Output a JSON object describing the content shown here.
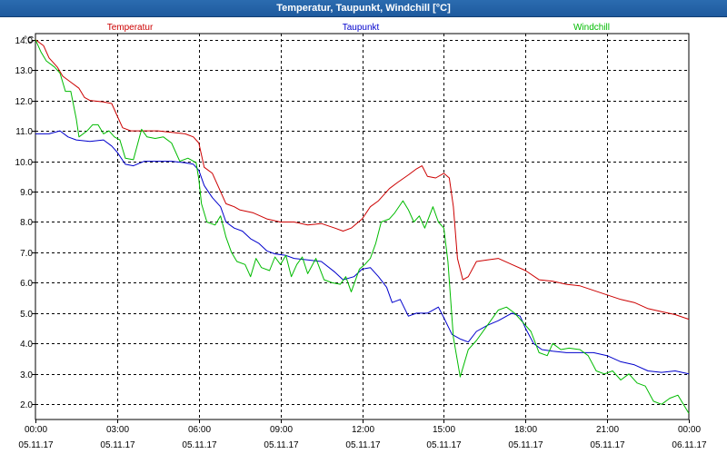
{
  "window": {
    "title": "Temperatur, Taupunkt, Windchill [°C]"
  },
  "chart_data": {
    "type": "line",
    "title": "Temperatur, Taupunkt, Windchill [°C]",
    "ylabel": "°C",
    "xlabel": "",
    "ylim": [
      1.5,
      14.2
    ],
    "xlim": [
      0,
      24
    ],
    "grid": true,
    "y_ticks": [
      "2.0",
      "3.0",
      "4.0",
      "5.0",
      "6.0",
      "7.0",
      "8.0",
      "9.0",
      "10.0",
      "11.0",
      "12.0",
      "13.0",
      "14.0"
    ],
    "y_tick_values": [
      2,
      3,
      4,
      5,
      6,
      7,
      8,
      9,
      10,
      11,
      12,
      13,
      14
    ],
    "x_ticks": [
      {
        "x": 0,
        "time": "00:00",
        "date": "05.11.17"
      },
      {
        "x": 3,
        "time": "03:00",
        "date": "05.11.17"
      },
      {
        "x": 6,
        "time": "06:00",
        "date": "05.11.17"
      },
      {
        "x": 9,
        "time": "09:00",
        "date": "05.11.17"
      },
      {
        "x": 12,
        "time": "12:00",
        "date": "05.11.17"
      },
      {
        "x": 15,
        "time": "15:00",
        "date": "05.11.17"
      },
      {
        "x": 18,
        "time": "18:00",
        "date": "05.11.17"
      },
      {
        "x": 21,
        "time": "21:00",
        "date": "05.11.17"
      },
      {
        "x": 24,
        "time": "00:00",
        "date": "06.11.17"
      }
    ],
    "series": [
      {
        "name": "Temperatur",
        "color": "#cc0000",
        "points": [
          [
            0,
            14.0
          ],
          [
            0.3,
            13.8
          ],
          [
            0.5,
            13.4
          ],
          [
            0.8,
            13.1
          ],
          [
            1.0,
            12.8
          ],
          [
            1.3,
            12.6
          ],
          [
            1.6,
            12.4
          ],
          [
            1.8,
            12.1
          ],
          [
            2.0,
            12.0
          ],
          [
            2.5,
            11.95
          ],
          [
            2.8,
            11.9
          ],
          [
            3.0,
            11.5
          ],
          [
            3.2,
            11.1
          ],
          [
            3.5,
            11.0
          ],
          [
            4.0,
            11.0
          ],
          [
            4.5,
            11.0
          ],
          [
            5.0,
            10.95
          ],
          [
            5.5,
            10.9
          ],
          [
            5.8,
            10.8
          ],
          [
            6.0,
            10.6
          ],
          [
            6.2,
            9.8
          ],
          [
            6.5,
            9.6
          ],
          [
            6.7,
            9.2
          ],
          [
            7.0,
            8.6
          ],
          [
            7.3,
            8.5
          ],
          [
            7.5,
            8.4
          ],
          [
            8.0,
            8.3
          ],
          [
            8.5,
            8.1
          ],
          [
            9.0,
            8.0
          ],
          [
            9.5,
            8.0
          ],
          [
            10.0,
            7.9
          ],
          [
            10.5,
            7.95
          ],
          [
            11.0,
            7.8
          ],
          [
            11.3,
            7.7
          ],
          [
            11.6,
            7.8
          ],
          [
            12.0,
            8.1
          ],
          [
            12.3,
            8.5
          ],
          [
            12.6,
            8.7
          ],
          [
            13.0,
            9.1
          ],
          [
            13.3,
            9.3
          ],
          [
            13.7,
            9.55
          ],
          [
            14.0,
            9.75
          ],
          [
            14.2,
            9.85
          ],
          [
            14.4,
            9.5
          ],
          [
            14.7,
            9.45
          ],
          [
            15.0,
            9.6
          ],
          [
            15.2,
            9.45
          ],
          [
            15.35,
            8.5
          ],
          [
            15.5,
            6.8
          ],
          [
            15.7,
            6.1
          ],
          [
            15.9,
            6.2
          ],
          [
            16.2,
            6.7
          ],
          [
            16.6,
            6.75
          ],
          [
            17.0,
            6.8
          ],
          [
            17.5,
            6.6
          ],
          [
            18.0,
            6.4
          ],
          [
            18.5,
            6.1
          ],
          [
            19.0,
            6.05
          ],
          [
            19.5,
            5.95
          ],
          [
            20.0,
            5.9
          ],
          [
            20.5,
            5.75
          ],
          [
            21.0,
            5.6
          ],
          [
            21.5,
            5.45
          ],
          [
            22.0,
            5.35
          ],
          [
            22.5,
            5.15
          ],
          [
            23.0,
            5.05
          ],
          [
            23.5,
            4.95
          ],
          [
            24.0,
            4.8
          ]
        ]
      },
      {
        "name": "Taupunkt",
        "color": "#0000cc",
        "points": [
          [
            0,
            10.9
          ],
          [
            0.5,
            10.9
          ],
          [
            0.9,
            11.0
          ],
          [
            1.2,
            10.8
          ],
          [
            1.5,
            10.7
          ],
          [
            2.0,
            10.65
          ],
          [
            2.5,
            10.7
          ],
          [
            2.8,
            10.5
          ],
          [
            3.0,
            10.3
          ],
          [
            3.3,
            9.9
          ],
          [
            3.6,
            9.85
          ],
          [
            4.0,
            10.0
          ],
          [
            4.5,
            10.0
          ],
          [
            5.0,
            10.0
          ],
          [
            5.5,
            9.95
          ],
          [
            5.8,
            9.9
          ],
          [
            6.0,
            9.7
          ],
          [
            6.2,
            9.2
          ],
          [
            6.5,
            8.8
          ],
          [
            6.8,
            8.5
          ],
          [
            7.0,
            8.0
          ],
          [
            7.3,
            7.8
          ],
          [
            7.6,
            7.7
          ],
          [
            7.9,
            7.45
          ],
          [
            8.2,
            7.3
          ],
          [
            8.5,
            7.05
          ],
          [
            8.8,
            6.95
          ],
          [
            9.2,
            6.9
          ],
          [
            9.5,
            6.8
          ],
          [
            10.0,
            6.75
          ],
          [
            10.5,
            6.7
          ],
          [
            11.0,
            6.35
          ],
          [
            11.3,
            6.1
          ],
          [
            11.7,
            6.2
          ],
          [
            12.0,
            6.45
          ],
          [
            12.3,
            6.5
          ],
          [
            12.6,
            6.2
          ],
          [
            12.9,
            5.85
          ],
          [
            13.1,
            5.35
          ],
          [
            13.4,
            5.45
          ],
          [
            13.7,
            4.9
          ],
          [
            14.0,
            5.0
          ],
          [
            14.4,
            5.0
          ],
          [
            14.8,
            5.2
          ],
          [
            15.0,
            4.85
          ],
          [
            15.3,
            4.3
          ],
          [
            15.6,
            4.15
          ],
          [
            15.9,
            4.05
          ],
          [
            16.2,
            4.4
          ],
          [
            16.6,
            4.6
          ],
          [
            17.0,
            4.75
          ],
          [
            17.5,
            5.0
          ],
          [
            17.8,
            4.9
          ],
          [
            18.0,
            4.5
          ],
          [
            18.3,
            4.0
          ],
          [
            18.6,
            3.8
          ],
          [
            19.0,
            3.75
          ],
          [
            19.5,
            3.7
          ],
          [
            20.0,
            3.7
          ],
          [
            20.5,
            3.7
          ],
          [
            21.0,
            3.6
          ],
          [
            21.5,
            3.4
          ],
          [
            22.0,
            3.3
          ],
          [
            22.5,
            3.1
          ],
          [
            23.0,
            3.05
          ],
          [
            23.5,
            3.1
          ],
          [
            24.0,
            3.0
          ]
        ]
      },
      {
        "name": "Windchill",
        "color": "#00bb00",
        "points": [
          [
            0,
            14.0
          ],
          [
            0.2,
            13.6
          ],
          [
            0.4,
            13.3
          ],
          [
            0.7,
            13.1
          ],
          [
            0.9,
            12.9
          ],
          [
            1.1,
            12.3
          ],
          [
            1.3,
            12.3
          ],
          [
            1.5,
            11.4
          ],
          [
            1.6,
            10.8
          ],
          [
            1.9,
            11.0
          ],
          [
            2.1,
            11.2
          ],
          [
            2.3,
            11.2
          ],
          [
            2.5,
            10.9
          ],
          [
            2.7,
            11.0
          ],
          [
            2.9,
            10.8
          ],
          [
            3.1,
            10.7
          ],
          [
            3.3,
            10.1
          ],
          [
            3.6,
            10.05
          ],
          [
            3.9,
            11.05
          ],
          [
            4.1,
            10.8
          ],
          [
            4.4,
            10.75
          ],
          [
            4.7,
            10.8
          ],
          [
            5.0,
            10.6
          ],
          [
            5.3,
            10.0
          ],
          [
            5.6,
            10.1
          ],
          [
            5.9,
            9.95
          ],
          [
            6.0,
            9.4
          ],
          [
            6.1,
            8.6
          ],
          [
            6.3,
            8.0
          ],
          [
            6.6,
            7.9
          ],
          [
            6.8,
            8.2
          ],
          [
            7.0,
            7.5
          ],
          [
            7.2,
            7.0
          ],
          [
            7.4,
            6.7
          ],
          [
            7.7,
            6.6
          ],
          [
            7.9,
            6.2
          ],
          [
            8.1,
            6.8
          ],
          [
            8.3,
            6.5
          ],
          [
            8.6,
            6.4
          ],
          [
            8.8,
            6.85
          ],
          [
            9.0,
            6.6
          ],
          [
            9.2,
            6.9
          ],
          [
            9.4,
            6.2
          ],
          [
            9.6,
            6.6
          ],
          [
            9.8,
            6.85
          ],
          [
            10.0,
            6.3
          ],
          [
            10.3,
            6.8
          ],
          [
            10.6,
            6.1
          ],
          [
            10.9,
            6.0
          ],
          [
            11.2,
            5.95
          ],
          [
            11.4,
            6.2
          ],
          [
            11.6,
            5.7
          ],
          [
            11.9,
            6.45
          ],
          [
            12.1,
            6.6
          ],
          [
            12.3,
            6.8
          ],
          [
            12.5,
            7.3
          ],
          [
            12.7,
            8.0
          ],
          [
            13.0,
            8.1
          ],
          [
            13.2,
            8.3
          ],
          [
            13.5,
            8.7
          ],
          [
            13.7,
            8.4
          ],
          [
            13.9,
            8.0
          ],
          [
            14.1,
            8.2
          ],
          [
            14.3,
            7.8
          ],
          [
            14.6,
            8.5
          ],
          [
            14.8,
            8.0
          ],
          [
            15.0,
            7.8
          ],
          [
            15.15,
            6.7
          ],
          [
            15.35,
            4.2
          ],
          [
            15.6,
            2.9
          ],
          [
            15.9,
            3.8
          ],
          [
            16.2,
            4.1
          ],
          [
            16.6,
            4.6
          ],
          [
            17.0,
            5.1
          ],
          [
            17.3,
            5.2
          ],
          [
            17.6,
            5.0
          ],
          [
            17.9,
            4.7
          ],
          [
            18.2,
            4.4
          ],
          [
            18.5,
            3.7
          ],
          [
            18.8,
            3.6
          ],
          [
            19.0,
            4.0
          ],
          [
            19.3,
            3.8
          ],
          [
            19.6,
            3.85
          ],
          [
            20.0,
            3.8
          ],
          [
            20.3,
            3.6
          ],
          [
            20.6,
            3.1
          ],
          [
            20.9,
            3.0
          ],
          [
            21.2,
            3.1
          ],
          [
            21.5,
            2.8
          ],
          [
            21.8,
            3.0
          ],
          [
            22.1,
            2.7
          ],
          [
            22.4,
            2.6
          ],
          [
            22.7,
            2.1
          ],
          [
            23.0,
            2.0
          ],
          [
            23.3,
            2.2
          ],
          [
            23.6,
            2.3
          ],
          [
            24.0,
            1.7
          ]
        ]
      }
    ]
  }
}
